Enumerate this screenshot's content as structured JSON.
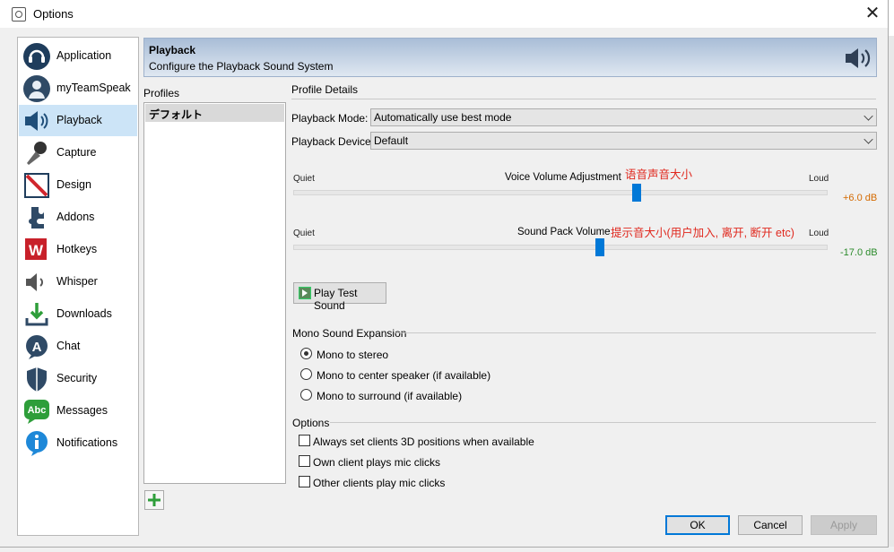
{
  "window": {
    "title": "Options",
    "close_glyph": "✕"
  },
  "sidebar": {
    "items": [
      {
        "label": "Application",
        "icon": "headset-icon"
      },
      {
        "label": "myTeamSpeak",
        "icon": "user-badge-icon"
      },
      {
        "label": "Playback",
        "icon": "speaker-icon",
        "active": true
      },
      {
        "label": "Capture",
        "icon": "microphone-icon"
      },
      {
        "label": "Design",
        "icon": "design-icon"
      },
      {
        "label": "Addons",
        "icon": "puzzle-icon"
      },
      {
        "label": "Hotkeys",
        "icon": "hotkey-w-icon"
      },
      {
        "label": "Whisper",
        "icon": "whisper-speaker-icon"
      },
      {
        "label": "Downloads",
        "icon": "download-icon"
      },
      {
        "label": "Chat",
        "icon": "chat-a-icon"
      },
      {
        "label": "Security",
        "icon": "shield-icon"
      },
      {
        "label": "Messages",
        "icon": "messages-abc-icon"
      },
      {
        "label": "Notifications",
        "icon": "info-icon"
      }
    ]
  },
  "header": {
    "title": "Playback",
    "subtitle": "Configure the Playback Sound System"
  },
  "profiles": {
    "label": "Profiles",
    "items": [
      "デフォルト"
    ]
  },
  "details": {
    "label": "Profile Details",
    "playback_mode": {
      "label": "Playback Mode:",
      "value": "Automatically use best mode"
    },
    "playback_device": {
      "label": "Playback Device:",
      "value": "Default"
    },
    "voice_volume": {
      "quiet": "Quiet",
      "title": "Voice Volume Adjustment",
      "loud": "Loud",
      "db": "+6.0 dB",
      "db_color": "#d46a00",
      "annotation": "语音声音大小",
      "position": 0.643
    },
    "sound_pack": {
      "quiet": "Quiet",
      "title": "Sound Pack Volume",
      "loud": "Loud",
      "db": "-17.0 dB",
      "db_color": "#2a8a2a",
      "annotation": "提示音大小(用户加入, 离开, 断开 etc)",
      "position": 0.573
    },
    "play_test": "Play Test Sound",
    "mono": {
      "title": "Mono Sound Expansion",
      "options": [
        "Mono to stereo",
        "Mono to center speaker (if available)",
        "Mono to surround (if available)"
      ],
      "selected": 0
    },
    "options": {
      "title": "Options",
      "items": [
        "Always set clients 3D positions when available",
        "Own client plays mic clicks",
        "Other clients play mic clicks"
      ]
    }
  },
  "buttons": {
    "ok": "OK",
    "cancel": "Cancel",
    "apply": "Apply"
  },
  "colors": {
    "accent": "#0078d7",
    "selection": "#cce4f7",
    "annotation": "#e0281e"
  }
}
